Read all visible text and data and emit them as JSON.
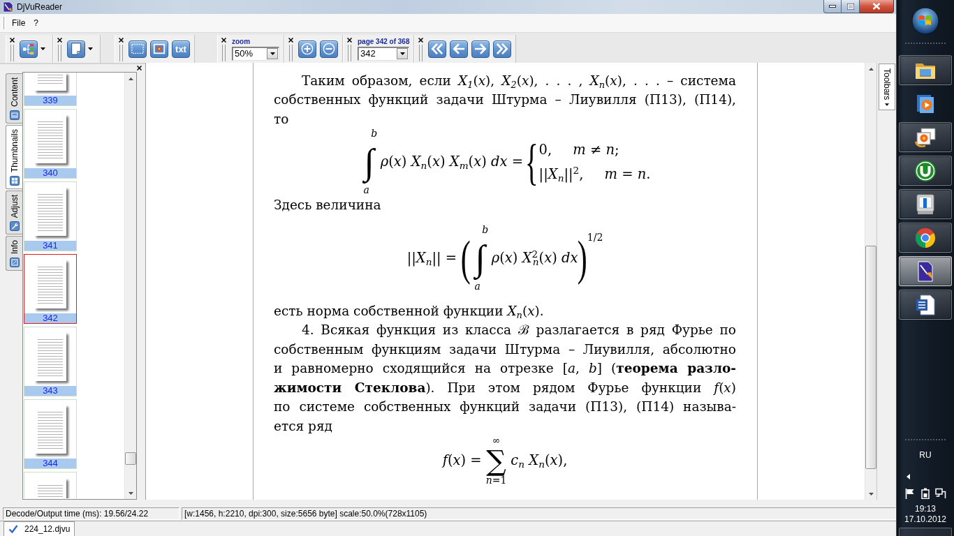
{
  "window": {
    "title": "DjVuReader"
  },
  "menu": [
    {
      "label": "File"
    },
    {
      "label": "?"
    }
  ],
  "toolbar": [
    {
      "kind": "buttons",
      "buttons": [
        {
          "kind": "icon"
        }
      ]
    },
    {
      "kind": "buttons",
      "buttons": [
        {
          "kind": "icon"
        }
      ]
    },
    {
      "kind": "buttons",
      "buttons": [
        {
          "kind": "icon"
        },
        {
          "kind": "icon"
        },
        {
          "kind": "text",
          "label": "txt"
        }
      ]
    },
    {
      "kind": "combo",
      "label": "zoom",
      "value": "50%"
    },
    {
      "kind": "buttons",
      "buttons": [
        {
          "kind": "icon"
        },
        {
          "kind": "icon"
        }
      ]
    },
    {
      "kind": "combo",
      "label": "page 342 of 368",
      "value": "342"
    },
    {
      "kind": "buttons",
      "buttons": [
        {
          "kind": "icon"
        },
        {
          "kind": "icon"
        },
        {
          "kind": "icon"
        },
        {
          "kind": "icon"
        }
      ]
    }
  ],
  "side_panel": {
    "tabs": [
      {
        "label": "Content",
        "selected": false
      },
      {
        "label": "Thumbnails",
        "selected": true
      },
      {
        "label": "Adjust",
        "selected": false
      },
      {
        "label": "Info",
        "selected": false
      }
    ],
    "thumbnails": [
      {
        "page": "339",
        "selected": false
      },
      {
        "page": "340",
        "selected": false
      },
      {
        "page": "341",
        "selected": false
      },
      {
        "page": "342",
        "selected": true
      },
      {
        "page": "343",
        "selected": false
      },
      {
        "page": "344",
        "selected": false
      },
      {
        "selected": false
      }
    ]
  },
  "document": {
    "blocks": [
      {
        "kind": "paragraph",
        "lines": [
          "Таким образом, если *X*$_{1}$(*x*), *X*$_{2}$(*x*), . . . , *X*$_{n}$(*x*), . . . – система",
          "собственных функций задачи Штурма – Лиувилля (П13), (П14),",
          "то"
        ]
      },
      {
        "kind": "formula",
        "parts": [
          {
            "kind": "integral",
            "sign": "∫",
            "upper": "b",
            "lower": "a"
          },
          {
            "kind": "text",
            "text": "*ρ*(*x*) *X*$_{n}$(*x*) *X*$_{m}$(*x*) *dx* ="
          },
          {
            "kind": "cases",
            "brace": "{",
            "rows": [
              [
                "0,",
                "*m* ≠ *n*;"
              ],
              [
                "||*X*$_{n}$||$^{2}$,",
                "*m* = *n*."
              ]
            ]
          }
        ]
      },
      {
        "kind": "continuation",
        "lines": [
          "Здесь величина"
        ]
      },
      {
        "kind": "formula",
        "parts": [
          {
            "kind": "text",
            "text": "||*X*$_{n}$|| ="
          },
          {
            "kind": "parens",
            "open": "(",
            "close": ")",
            "exponent": "1/2",
            "parts": [
              {
                "kind": "integral",
                "sign": "∫",
                "upper": "b",
                "lower": "a"
              },
              {
                "kind": "text",
                "text": "*ρ*(*x*) *X*$^{2}$$_{n}$(*x*) *dx*"
              }
            ]
          }
        ]
      },
      {
        "kind": "continuation",
        "lines": [
          "есть норма собственной функции *X*$_{n}$(*x*)."
        ]
      },
      {
        "kind": "paragraph",
        "lines": [
          "4. Всякая функция из класса ℬ разлагается в ряд Фурье по",
          "собственным функциям задачи Штурма – Лиувилля, абсолютно",
          "и равномерно сходящийся на отрезке [*a*, *b*] (**теорема разло-**",
          "**жимости Стеклова**). При этом рядом Фурье функции *f*(*x*)",
          "по системе собственных функций задачи (П13), (П14) называ-",
          "ется ряд"
        ]
      },
      {
        "kind": "formula",
        "parts": [
          {
            "kind": "text",
            "text": "*f*(*x*) ="
          },
          {
            "kind": "sum",
            "sign": "∑",
            "upper": "∞",
            "lower": "*n*=1"
          },
          {
            "kind": "text",
            "text": "*c*$_{n}$ *X*$_{n}$(*x*),"
          }
        ]
      }
    ]
  },
  "right_dock": {
    "tabs": [
      {
        "label": "Toolbars"
      }
    ]
  },
  "status_bar": [
    "Decode/Output time (ms): 19.56/24.22",
    "[w:1456, h:2210, dpi:300, size:5656 byte] scale:50.0%(728x1105)"
  ],
  "doc_tabs": [
    {
      "label": "224_12.djvu",
      "selected": true
    }
  ],
  "taskbar": {
    "items": [
      {
        "running": true,
        "active": false
      },
      {
        "running": false,
        "active": false
      },
      {
        "running": true,
        "active": false
      },
      {
        "running": true,
        "active": false
      },
      {
        "running": true,
        "active": false
      },
      {
        "running": true,
        "active": false
      },
      {
        "running": true,
        "active": true
      },
      {
        "running": true,
        "active": false
      }
    ],
    "tray": {
      "language": "RU",
      "time": "19:13",
      "date": "17.10.2012"
    }
  }
}
